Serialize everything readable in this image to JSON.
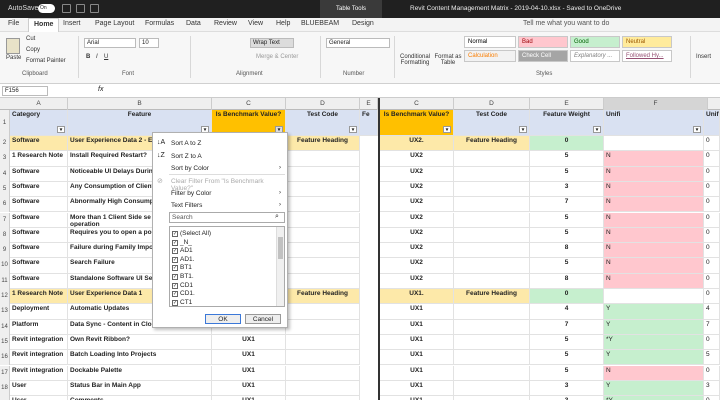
{
  "titlebar": {
    "autosave": "AutoSave",
    "toggle": "On",
    "tools": "Table Tools",
    "doc": "Revit Content Management Matrix - 2019-04-10.xlsx - Saved to OneDrive"
  },
  "tabs": [
    "File",
    "Home",
    "Insert",
    "Page Layout",
    "Formulas",
    "Data",
    "Review",
    "View",
    "Help",
    "BLUEBEAM",
    "Design"
  ],
  "tell": "Tell me what you want to do",
  "ribbon": {
    "clipboard": "Clipboard",
    "paste": "Paste",
    "cut": "Cut",
    "copy": "Copy",
    "painter": "Format Painter",
    "font": "Font",
    "font_name": "Arial",
    "font_size": "10",
    "alignment": "Alignment",
    "wrap": "Wrap Text",
    "merge": "Merge & Center",
    "number": "Number",
    "num_format": "General",
    "cond": "Conditional Formatting",
    "fmt_table": "Format as Table",
    "styles_label": "Styles",
    "insert": "Insert",
    "styles": [
      {
        "label": "Normal",
        "bg": "#ffffff",
        "fg": "#000000"
      },
      {
        "label": "Bad",
        "bg": "#ffc7ce",
        "fg": "#9c0006"
      },
      {
        "label": "Good",
        "bg": "#c6efce",
        "fg": "#006100"
      },
      {
        "label": "Neutral",
        "bg": "#ffeb9c",
        "fg": "#9c5700"
      },
      {
        "label": "Calculation",
        "bg": "#f2f2f2",
        "fg": "#fa7d00"
      },
      {
        "label": "Check Cell",
        "bg": "#a5a5a5",
        "fg": "#ffffff"
      },
      {
        "label": "Explanatory ...",
        "bg": "#ffffff",
        "fg": "#7f7f7f"
      },
      {
        "label": "Followed Hy...",
        "bg": "#ffffff",
        "fg": "#954f72"
      }
    ]
  },
  "formula": {
    "cell": "F156",
    "fx": "fx"
  },
  "columns": [
    "A",
    "B",
    "C",
    "D",
    "E",
    "C",
    "D",
    "E",
    "F"
  ],
  "headers": {
    "category": "Category",
    "feature": "Feature",
    "benchmark": "Is Benchmark Value?",
    "testcode": "Test Code",
    "f": "Fe",
    "weight": "Feature Weight",
    "unifi": "Unifi",
    "unifi2": "Unifi"
  },
  "rows": [
    {
      "n": "2",
      "a": "Software",
      "b": "User Experience Data 2 - E",
      "c": "",
      "d": "Feature Heading",
      "c2": "UX2.",
      "d2": "Feature Heading",
      "e": "0",
      "f": "",
      "g": "0",
      "hl": true
    },
    {
      "n": "3",
      "a": "1 Research Note",
      "b": "Install Required Restart?",
      "c": "",
      "d": "",
      "c2": "UX2",
      "d2": "",
      "e": "5",
      "f": "N",
      "g": "0"
    },
    {
      "n": "4",
      "a": "Software",
      "b": "Noticeable UI Delays Durin",
      "c": "",
      "d": "",
      "c2": "UX2",
      "d2": "",
      "e": "5",
      "f": "N",
      "g": "0"
    },
    {
      "n": "5",
      "a": "Software",
      "b": "Any Consumption of Client",
      "c": "",
      "d": "",
      "c2": "UX2",
      "d2": "",
      "e": "3",
      "f": "N",
      "g": "0"
    },
    {
      "n": "6",
      "a": "Software",
      "b": "Abnormally High Consump Resources",
      "c": "",
      "d": "",
      "c2": "UX2",
      "d2": "",
      "e": "7",
      "f": "N",
      "g": "0"
    },
    {
      "n": "7",
      "a": "Software",
      "b": "More than 1 Client Side se predictable operation",
      "c": "",
      "d": "",
      "c2": "UX2",
      "d2": "",
      "e": "5",
      "f": "N",
      "g": "0"
    },
    {
      "n": "8",
      "a": "Software",
      "b": "Requires you to open a po before it will work",
      "c": "",
      "d": "",
      "c2": "UX2",
      "d2": "",
      "e": "5",
      "f": "N",
      "g": "0"
    },
    {
      "n": "9",
      "a": "Software",
      "b": "Failure during Family Impo Intervention",
      "c": "",
      "d": "",
      "c2": "UX2",
      "d2": "",
      "e": "8",
      "f": "N",
      "g": "0"
    },
    {
      "n": "10",
      "a": "Software",
      "b": "Search Failure",
      "c": "",
      "d": "",
      "c2": "UX2",
      "d2": "",
      "e": "5",
      "f": "N",
      "g": "0"
    },
    {
      "n": "11",
      "a": "Software",
      "b": "Standalone Software UI Se",
      "c": "",
      "d": "",
      "c2": "UX2",
      "d2": "",
      "e": "8",
      "f": "N",
      "g": "0"
    },
    {
      "n": "12",
      "a": "1 Research Note",
      "b": "User Experience Data 1",
      "c": "",
      "d": "Feature Heading",
      "c2": "UX1.",
      "d2": "Feature Heading",
      "e": "0",
      "f": "",
      "g": "0",
      "hl": true
    },
    {
      "n": "13",
      "a": "Deployment",
      "b": "Automatic Updates",
      "c": "",
      "d": "",
      "c2": "UX1",
      "d2": "",
      "e": "4",
      "f": "Y",
      "g": "4"
    },
    {
      "n": "14",
      "a": "Platform",
      "b": "Data Sync - Content in Clo",
      "c": "",
      "d": "",
      "c2": "UX1",
      "d2": "",
      "e": "7",
      "f": "Y",
      "g": "7"
    },
    {
      "n": "15",
      "a": "Revit integration",
      "b": "Own Revit Ribbon?",
      "c": "UX1",
      "d": "",
      "c2": "UX1",
      "d2": "",
      "e": "5",
      "f": "*Y",
      "g": "0"
    },
    {
      "n": "16",
      "a": "Revit integration",
      "b": "Batch Loading Into Projects",
      "c": "UX1",
      "d": "",
      "c2": "UX1",
      "d2": "",
      "e": "5",
      "f": "Y",
      "g": "5"
    },
    {
      "n": "17",
      "a": "Revit integration",
      "b": "Dockable Palette",
      "c": "UX1",
      "d": "",
      "c2": "UX1",
      "d2": "",
      "e": "5",
      "f": "N",
      "g": "0"
    },
    {
      "n": "18",
      "a": "User",
      "b": "Status Bar in Main App",
      "c": "UX1",
      "d": "",
      "c2": "UX1",
      "d2": "",
      "e": "3",
      "f": "Y",
      "g": "3"
    },
    {
      "n": "19",
      "a": "User",
      "b": "Comments",
      "c": "UX1",
      "d": "",
      "c2": "UX1",
      "d2": "",
      "e": "3",
      "f": "*Y",
      "g": "0"
    }
  ],
  "menu": {
    "sort_az": "Sort A to Z",
    "sort_za": "Sort Z to A",
    "sort_color": "Sort by Color",
    "clear": "Clear Filter From \"Is Benchmark Value?\"",
    "filter_color": "Filter by Color",
    "text_filters": "Text Filters",
    "search": "Search",
    "items": [
      "(Select All)",
      "_N_",
      "AD1",
      "AD1.",
      "BT1",
      "BT1.",
      "CD1",
      "CD1.",
      "CT1"
    ],
    "ok": "OK",
    "cancel": "Cancel"
  },
  "colors": {
    "header_orange": "#ffc000",
    "row_heading": "#fde9a9",
    "green": "#c6efce",
    "red": "#ffc7ce"
  }
}
